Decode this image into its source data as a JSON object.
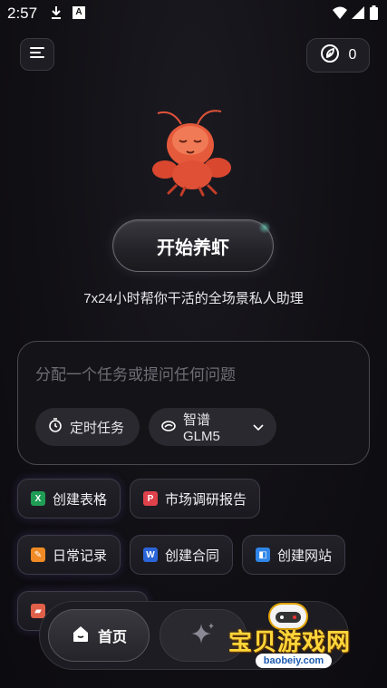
{
  "status_bar": {
    "time": "2:57",
    "icons": [
      "download-icon",
      "a-text-icon",
      "wifi-icon",
      "signal-icon",
      "battery-icon"
    ],
    "a_label": "A"
  },
  "header": {
    "menu_icon": "menu-icon",
    "points_icon": "leaf-coin-icon",
    "points_value": "0"
  },
  "hero": {
    "mascot": "lobster-mascot",
    "start_button": "开始养虾",
    "subtitle": "7x24小时帮你干活的全场景私人助理"
  },
  "composer": {
    "placeholder": "分配一个任务或提问任何问题",
    "scheduled_task_label": "定时任务",
    "model_label": "智谱 GLM5"
  },
  "quick_actions": [
    {
      "label": "创建表格",
      "icon": "excel-icon",
      "color": "#1f9d55",
      "glyph": "X"
    },
    {
      "label": "市场调研报告",
      "icon": "pdf-icon",
      "color": "#e0424b",
      "glyph": "P"
    },
    {
      "label": "日常记录",
      "icon": "note-icon",
      "color": "#f08a24",
      "glyph": "✎"
    },
    {
      "label": "创建合同",
      "icon": "word-icon",
      "color": "#2b66d9",
      "glyph": "W"
    },
    {
      "label": "创建网站",
      "icon": "web-icon",
      "color": "#2f86e8",
      "glyph": "◧"
    },
    {
      "label": "",
      "icon": "image-icon",
      "color": "#e0604a",
      "glyph": "▰"
    }
  ],
  "bottom_nav": {
    "home_label": "首页",
    "explore_icon": "sparkle-icon"
  },
  "watermark": {
    "text": "宝贝游戏网",
    "url": "baobeiy.com"
  },
  "colors": {
    "background": "#111015",
    "card_border": "#4a4950",
    "chip_bg": "#2a292f",
    "accent_watermark": "#ffd63a"
  }
}
